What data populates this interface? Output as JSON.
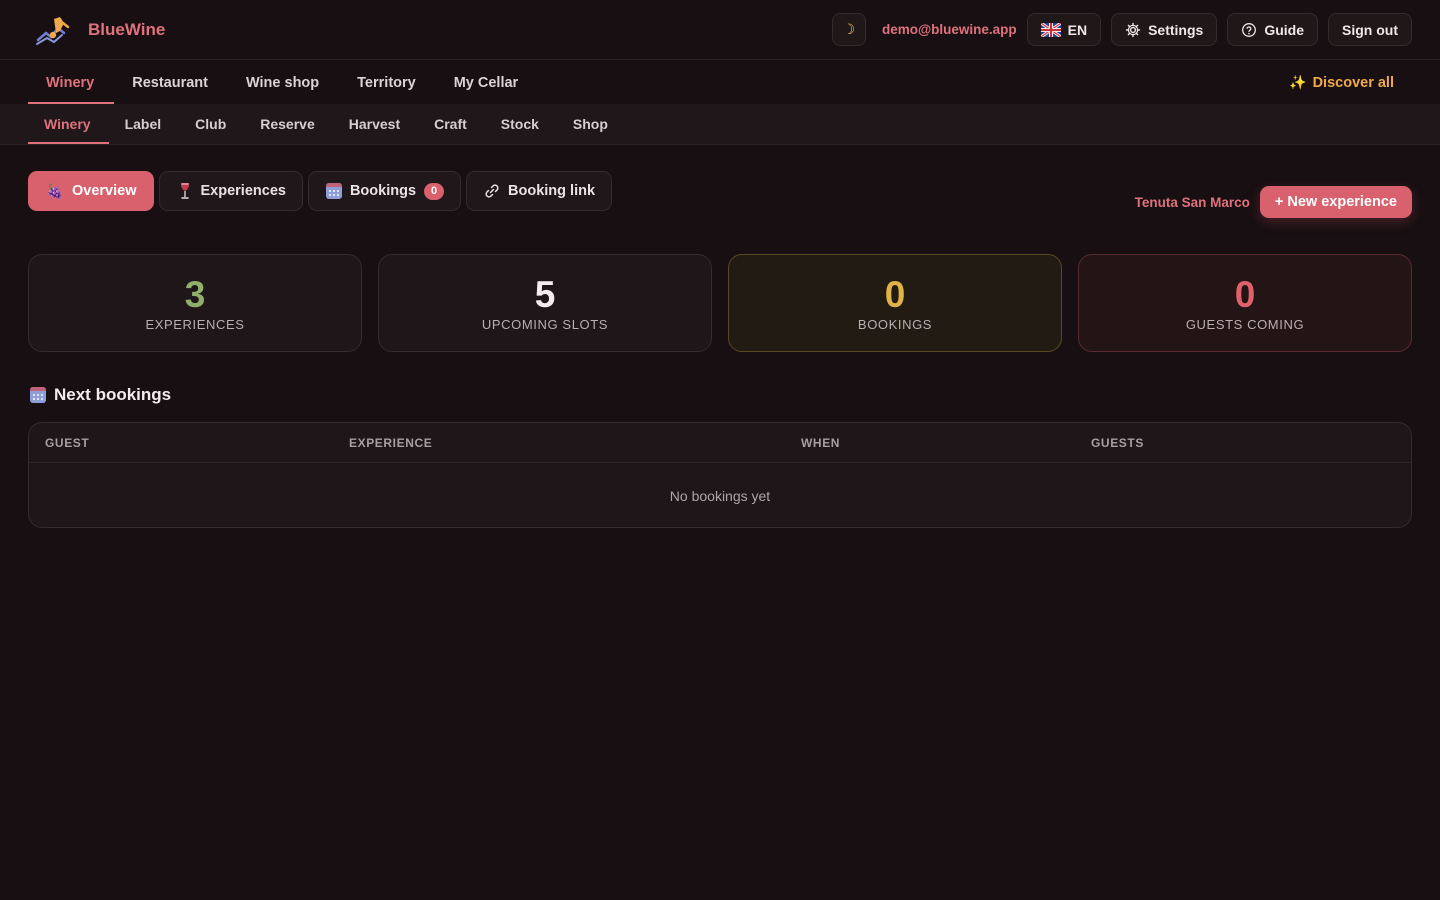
{
  "app": {
    "name": "BlueWine"
  },
  "header": {
    "email": "demo@bluewine.app",
    "language": "EN",
    "settings_label": "Settings",
    "guide_label": "Guide",
    "signout_label": "Sign out",
    "theme_icon": "moon-icon"
  },
  "nav_primary": {
    "items": [
      "Winery",
      "Restaurant",
      "Wine shop",
      "Territory",
      "My Cellar"
    ],
    "active": "Winery",
    "discover_label": "Discover all"
  },
  "nav_secondary": {
    "items": [
      "Winery",
      "Label",
      "Club",
      "Reserve",
      "Harvest",
      "Craft",
      "Stock",
      "Shop"
    ],
    "active": "Winery"
  },
  "tabs": {
    "overview": "Overview",
    "experiences": "Experiences",
    "bookings": "Bookings",
    "bookings_count": "0",
    "booking_link": "Booking link"
  },
  "actions": {
    "winery_name": "Tenuta San Marco",
    "new_experience": "+ New experience"
  },
  "stats": [
    {
      "value": "3",
      "label": "EXPERIENCES"
    },
    {
      "value": "5",
      "label": "UPCOMING SLOTS"
    },
    {
      "value": "0",
      "label": "BOOKINGS"
    },
    {
      "value": "0",
      "label": "GUESTS COMING"
    }
  ],
  "bookings_table": {
    "title": "Next bookings",
    "columns": [
      "GUEST",
      "EXPERIENCE",
      "WHEN",
      "GUESTS"
    ],
    "empty_text": "No bookings yet"
  },
  "colors": {
    "accent": "#d9606d",
    "discover": "#f0a94b",
    "stat_green": "#8fb06a",
    "stat_gold": "#dfb347",
    "stat_red": "#e0606b"
  }
}
